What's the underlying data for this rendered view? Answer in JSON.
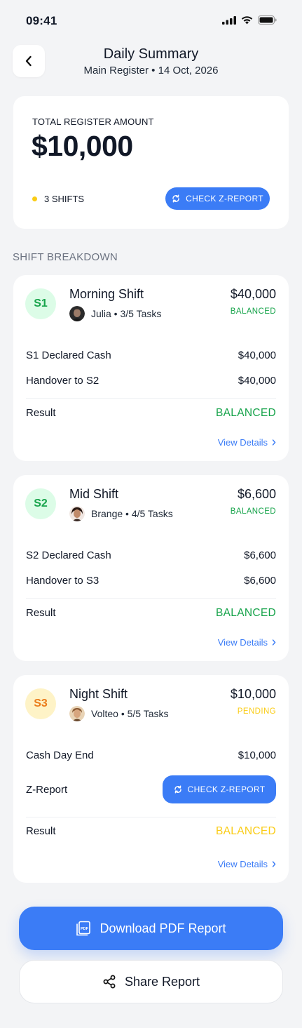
{
  "status_bar": {
    "time": "09:41"
  },
  "header": {
    "title": "Daily Summary",
    "subtitle": "Main Register • 14 Oct, 2026"
  },
  "summary": {
    "label": "TOTAL REGISTER AMOUNT",
    "amount": "$10,000",
    "shift_count": "3 SHIFTS",
    "shift_dot_color": "#facc15",
    "z_report_button": "CHECK Z-REPORT"
  },
  "section_label": "SHIFT BREAKDOWN",
  "shifts": [
    {
      "badge": "S1",
      "name": "Morning Shift",
      "meta": "Julia • 3/5 Tasks",
      "amount": "$40,000",
      "status": "BALANCED",
      "rows": [
        {
          "label": "S1 Declared Cash",
          "value": "$40,000"
        },
        {
          "label": "Handover to S2",
          "value": "$40,000"
        }
      ],
      "result_label": "Result",
      "result_value": "BALANCED",
      "link": "View Details"
    },
    {
      "badge": "S2",
      "name": "Mid Shift",
      "meta": "Brange • 4/5 Tasks",
      "amount": "$6,600",
      "status": "BALANCED",
      "rows": [
        {
          "label": "S2 Declared Cash",
          "value": "$6,600"
        },
        {
          "label": "Handover to S3",
          "value": "$6,600"
        }
      ],
      "result_label": "Result",
      "result_value": "BALANCED",
      "link": "View Details"
    },
    {
      "badge": "S3",
      "name": "Night Shift",
      "meta": "Volteo • 5/5 Tasks",
      "amount": "$10,000",
      "status": "PENDING",
      "rows": [
        {
          "label": "Cash Day End",
          "value": "$10,000"
        },
        {
          "label": "Z-Report",
          "value": "CHECK Z-REPORT"
        }
      ],
      "result_label": "Result",
      "result_value": "BALANCED",
      "link": "View Details"
    }
  ],
  "actions": {
    "download": "Download PDF Report",
    "share": "Share Report"
  },
  "colors": {
    "accent": "#3b7cf6",
    "balanced": "#16a34a",
    "pending": "#facc15",
    "background": "#f3f4f6"
  }
}
